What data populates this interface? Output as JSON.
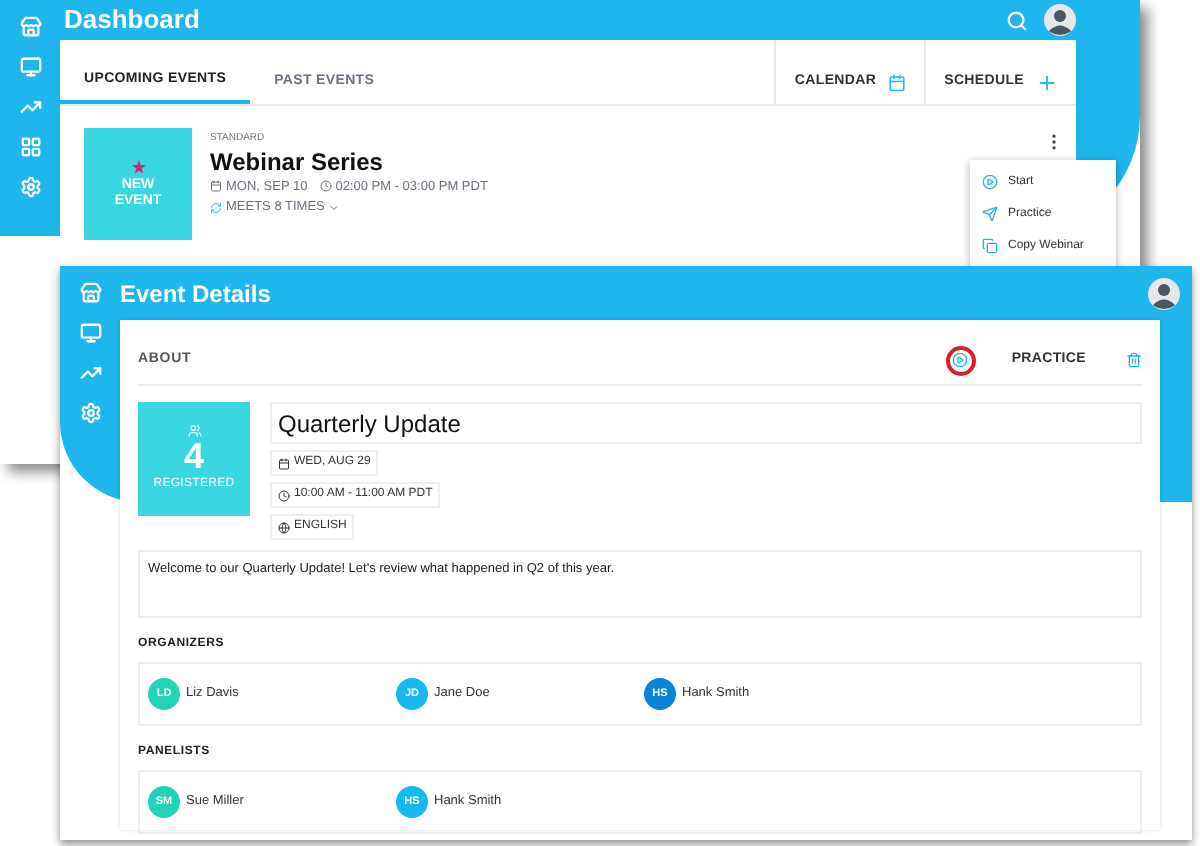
{
  "dashboard": {
    "title": "Dashboard",
    "tabs": [
      {
        "label": "UPCOMING EVENTS",
        "selected": true
      },
      {
        "label": "PAST EVENTS",
        "selected": false
      }
    ],
    "actions": [
      "CALENDAR",
      "SCHEDULE"
    ],
    "event": {
      "badge": "NEW EVENT",
      "type": "STANDARD",
      "title": "Webinar Series",
      "date": "MON, SEP 10",
      "time": "02:00 PM - 03:00 PM PDT",
      "recurrence": "MEETS 8 TIMES"
    },
    "menu": [
      "Start",
      "Practice",
      "Copy Webinar"
    ]
  },
  "details": {
    "title": "Event Details",
    "section": "ABOUT",
    "practice": "PRACTICE",
    "count": "4",
    "count_label": "REGISTERED",
    "event_title": "Quarterly Update",
    "date": "WED, AUG 29",
    "time": "10:00 AM - 11:00 AM PDT",
    "language": "ENGLISH",
    "description": "Welcome to our Quarterly Update! Let's review what happened in Q2 of this year.",
    "groups": [
      {
        "label": "ORGANIZERS",
        "people": [
          {
            "initials": "LD",
            "name": "Liz Davis",
            "color": "#22d3b8"
          },
          {
            "initials": "JD",
            "name": "Jane Doe",
            "color": "#16b8f0"
          },
          {
            "initials": "HS",
            "name": "Hank Smith",
            "color": "#0b84d8"
          }
        ]
      },
      {
        "label": "PANELISTS",
        "people": [
          {
            "initials": "SM",
            "name": "Sue Miller",
            "color": "#22d3b8"
          },
          {
            "initials": "HS",
            "name": "Hank Smith",
            "color": "#16b8f0"
          }
        ]
      }
    ]
  }
}
